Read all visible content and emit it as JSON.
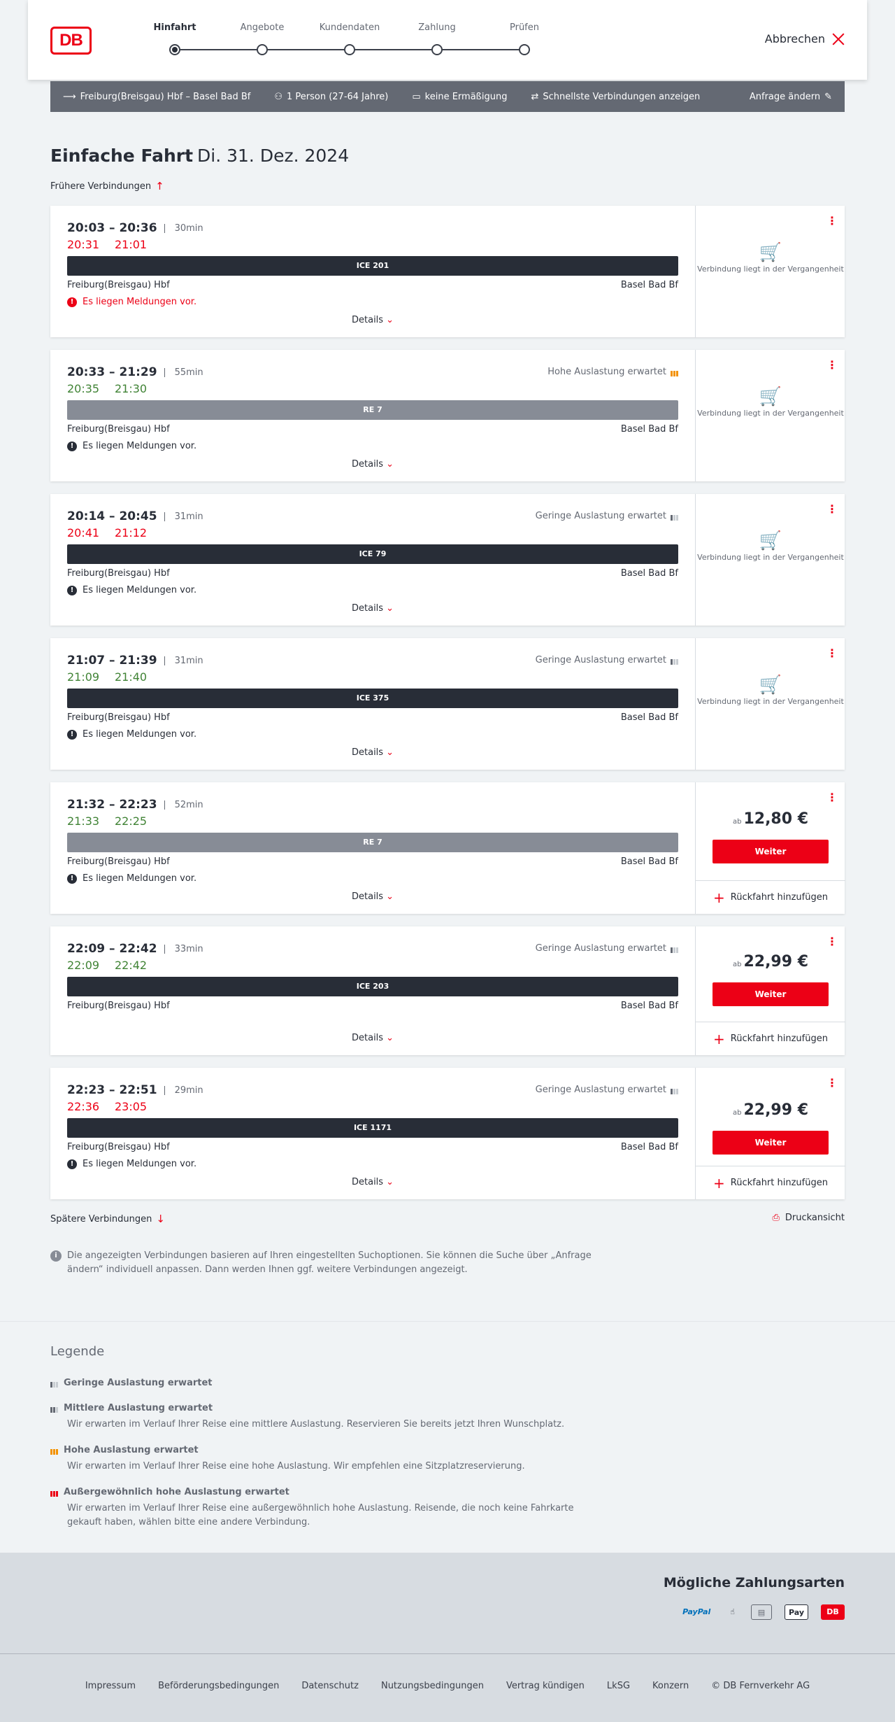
{
  "header": {
    "logo_text": "DB",
    "cancel_label": "Abbrechen",
    "steps": [
      {
        "label": "Hinfahrt",
        "active": true
      },
      {
        "label": "Angebote",
        "active": false
      },
      {
        "label": "Kundendaten",
        "active": false
      },
      {
        "label": "Zahlung",
        "active": false
      },
      {
        "label": "Prüfen",
        "active": false
      }
    ]
  },
  "summary": {
    "route": "Freiburg(Breisgau) Hbf – Basel Bad Bf",
    "travelers": "1 Person (27-64 Jahre)",
    "discount": "keine Ermäßigung",
    "option": "Schnellste Verbindungen anzeigen",
    "change_label": "Anfrage ändern"
  },
  "page": {
    "title": "Einfache Fahrt",
    "date": "Di. 31. Dez. 2024",
    "earlier_label": "Frühere Verbindungen",
    "later_label": "Spätere Verbindungen",
    "print_label": "Druckansicht",
    "info_text": "Die angezeigten Verbindungen basieren auf Ihren eingestellten Suchoptionen. Sie können die Suche über „Anfrage ändern“ individuell anpassen. Dann werden Ihnen ggf. weitere Verbindungen angezeigt."
  },
  "connections": [
    {
      "times": "20:03 – 20:36",
      "duration": "30min",
      "rt_dep": "20:31",
      "rt_arr": "21:01",
      "rt_color": "red",
      "load": "",
      "train": "ICE 201",
      "from": "Freiburg(Breisgau) Hbf",
      "to": "Basel Bad Bf",
      "message": "Es liegen Meldungen vor.",
      "details": "Details",
      "past": "Verbindung liegt in der Vergangenheit"
    },
    {
      "times": "20:33 – 21:29",
      "duration": "55min",
      "rt_dep": "20:35",
      "rt_arr": "21:30",
      "rt_color": "green",
      "load": "Hohe Auslastung erwartet",
      "train": "RE 7",
      "from": "Freiburg(Breisgau) Hbf",
      "to": "Basel Bad Bf",
      "message": "Es liegen Meldungen vor.",
      "details": "Details",
      "past": "Verbindung liegt in der Vergangenheit"
    },
    {
      "times": "20:14 – 20:45",
      "duration": "31min",
      "rt_dep": "20:41",
      "rt_arr": "21:12",
      "rt_color": "red",
      "load": "Geringe Auslastung erwartet",
      "train": "ICE 79",
      "from": "Freiburg(Breisgau) Hbf",
      "to": "Basel Bad Bf",
      "message": "Es liegen Meldungen vor.",
      "details": "Details",
      "past": "Verbindung liegt in der Vergangenheit"
    },
    {
      "times": "21:07 – 21:39",
      "duration": "31min",
      "rt_dep": "21:09",
      "rt_arr": "21:40",
      "rt_color": "green",
      "load": "Geringe Auslastung erwartet",
      "train": "ICE 375",
      "from": "Freiburg(Breisgau) Hbf",
      "to": "Basel Bad Bf",
      "message": "Es liegen Meldungen vor.",
      "details": "Details",
      "past": "Verbindung liegt in der Vergangenheit"
    },
    {
      "times": "21:32 – 22:23",
      "duration": "52min",
      "rt_dep": "21:33",
      "rt_arr": "22:25",
      "rt_color": "green",
      "load": "",
      "train": "RE 7",
      "from": "Freiburg(Breisgau) Hbf",
      "to": "Basel Bad Bf",
      "message": "Es liegen Meldungen vor.",
      "details": "Details",
      "price_prefix": "ab",
      "price": "12,80 €",
      "weiter": "Weiter",
      "return_label": "Rückfahrt hinzufügen"
    },
    {
      "times": "22:09 – 22:42",
      "duration": "33min",
      "rt_dep": "22:09",
      "rt_arr": "22:42",
      "rt_color": "green",
      "load": "Geringe Auslastung erwartet",
      "train": "ICE 203",
      "from": "Freiburg(Breisgau) Hbf",
      "to": "Basel Bad Bf",
      "message": "",
      "details": "Details",
      "price_prefix": "ab",
      "price": "22,99 €",
      "weiter": "Weiter",
      "return_label": "Rückfahrt hinzufügen"
    },
    {
      "times": "22:23 – 22:51",
      "duration": "29min",
      "rt_dep": "22:36",
      "rt_arr": "23:05",
      "rt_color": "red",
      "load": "Geringe Auslastung erwartet",
      "train": "ICE 1171",
      "from": "Freiburg(Breisgau) Hbf",
      "to": "Basel Bad Bf",
      "message": "Es liegen Meldungen vor.",
      "details": "Details",
      "price_prefix": "ab",
      "price": "22,99 €",
      "weiter": "Weiter",
      "return_label": "Rückfahrt hinzufügen"
    }
  ],
  "legend": {
    "title": "Legende",
    "items": [
      {
        "label": "Geringe Auslastung erwartet",
        "desc": ""
      },
      {
        "label": "Mittlere Auslastung erwartet",
        "desc": "Wir erwarten im Verlauf Ihrer Reise eine mittlere Auslastung. Reservieren Sie bereits jetzt Ihren Wunschplatz."
      },
      {
        "label": "Hohe Auslastung erwartet",
        "desc": "Wir erwarten im Verlauf Ihrer Reise eine hohe Auslastung. Wir empfehlen eine Sitzplatzreservierung."
      },
      {
        "label": "Außergewöhnlich hohe Auslastung erwartet",
        "desc": "Wir erwarten im Verlauf Ihrer Reise eine außergewöhnlich hohe Auslastung. Reisende, die noch keine Fahrkarte gekauft haben, wählen bitte eine andere Verbindung."
      }
    ]
  },
  "payments": {
    "title": "Mögliche Zahlungsarten",
    "methods": [
      "PayPal",
      "Pay",
      "DB"
    ]
  },
  "footer": {
    "links": [
      "Impressum",
      "Beförderungsbedingungen",
      "Datenschutz",
      "Nutzungsbedingungen",
      "Vertrag kündigen",
      "LkSG",
      "Konzern",
      "© DB Fernverkehr AG"
    ]
  },
  "colors": {
    "accent": "#ec0016",
    "delay": "#ec0016",
    "ontime": "#408335",
    "high_load": "#f39200"
  }
}
